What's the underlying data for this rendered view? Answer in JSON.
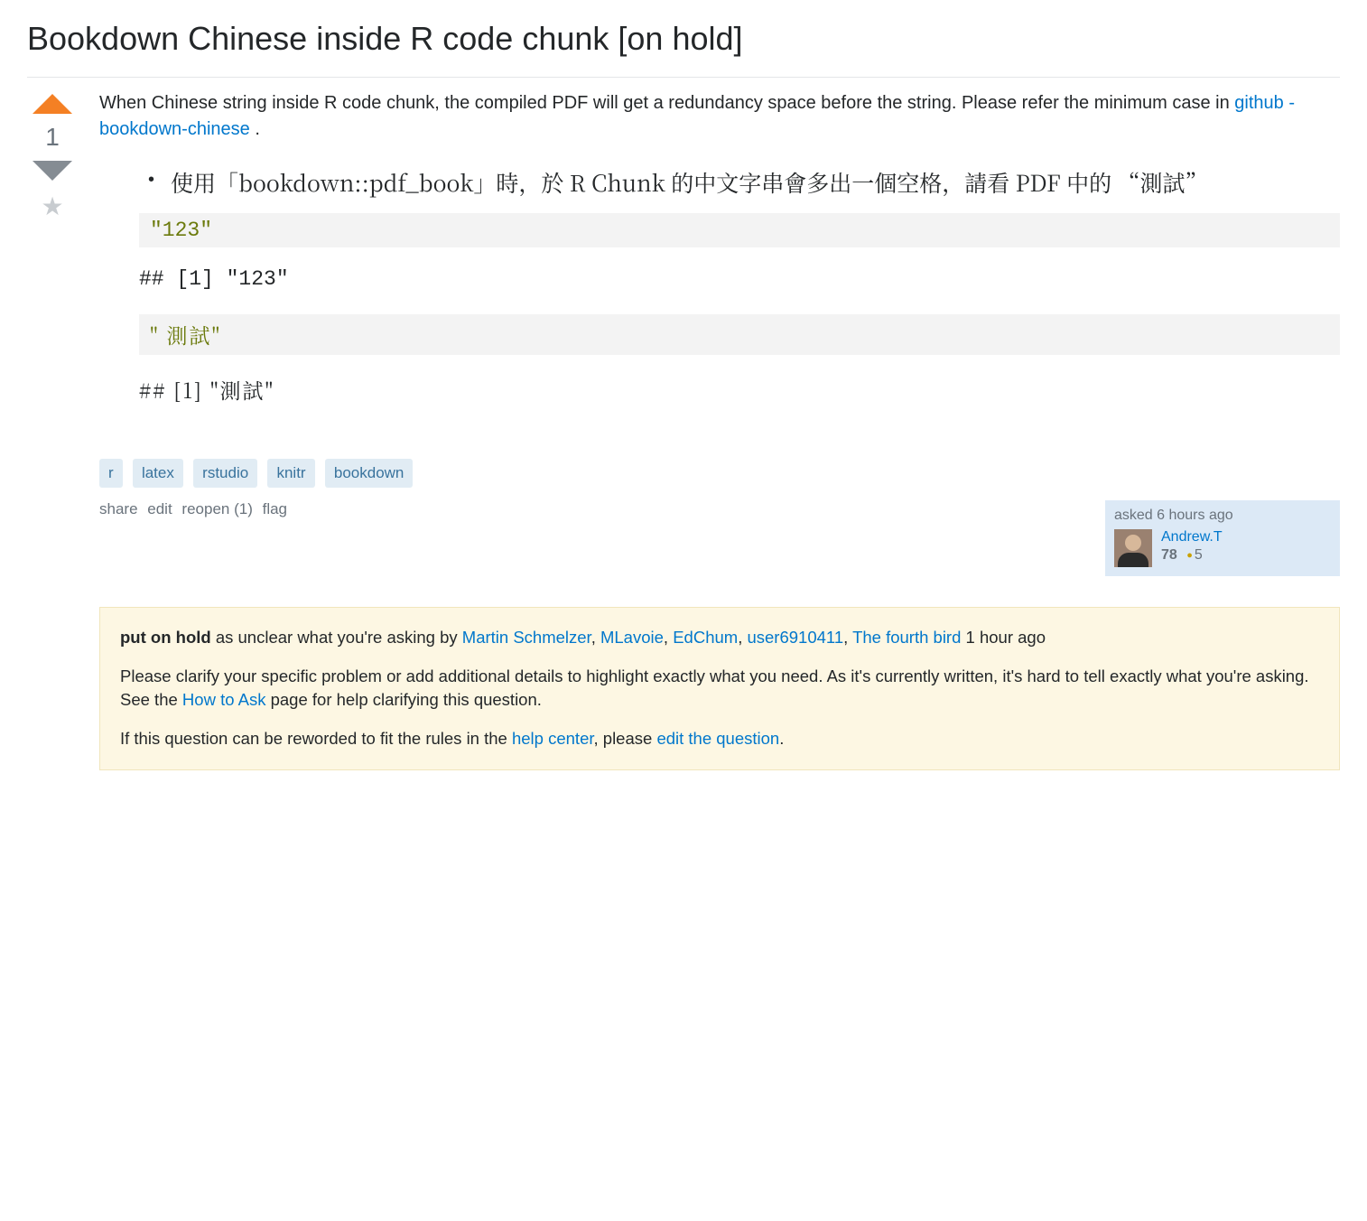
{
  "title": "Bookdown Chinese inside R code chunk [on hold]",
  "vote": {
    "count": "1"
  },
  "post": {
    "intro_before_link": "When Chinese string inside R code chunk, the compiled PDF will get a redundancy space before the string. Please refer the minimum case in ",
    "link_text": "github - bookdown-chinese",
    "intro_after_link": " .",
    "bullet": "使用「bookdown::pdf_book」時，於 R Chunk 的中文字串會多出一個空格，請看 PDF 中的 “測試”",
    "code1": "\"123\"",
    "out1": "## [1] \"123\"",
    "code2": "\" 測試\"",
    "out2": "## [1] \"測試\""
  },
  "tags": [
    "r",
    "latex",
    "rstudio",
    "knitr",
    "bookdown"
  ],
  "menu": {
    "share": "share",
    "edit": "edit",
    "reopen": "reopen (1)",
    "flag": "flag"
  },
  "user": {
    "asked": "asked 6 hours ago",
    "name": "Andrew.T",
    "rep": "78",
    "bronze": "5"
  },
  "notice": {
    "line1_bold": "put on hold",
    "line1_text": " as unclear what you're asking by ",
    "closers": [
      "Martin Schmelzer",
      "MLavoie",
      "EdChum",
      "user6910411",
      "The fourth bird"
    ],
    "line1_time": " 1 hour ago",
    "line2_before": "Please clarify your specific problem or add additional details to highlight exactly what you need. As it's currently written, it's hard to tell exactly what you're asking. See the ",
    "howtoask": "How to Ask",
    "line2_after": " page for help clarifying this question.",
    "line3_before": "If this question can be reworded to fit the rules in the ",
    "helpcenter": "help center",
    "line3_mid": ", please ",
    "editq": "edit the question",
    "line3_after": "."
  }
}
